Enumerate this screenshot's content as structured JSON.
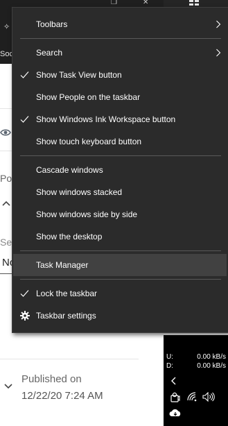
{
  "background": {
    "topbar_text": "Soc",
    "po_label": "Po",
    "se_label": "Se",
    "no_label": "No",
    "published_label": "Published on",
    "published_date": "12/22/20 7:24 AM"
  },
  "tray": {
    "upload_label": "U:",
    "upload_value": "0.00 kB/s",
    "download_label": "D:",
    "download_value": "0.00 kB/s",
    "icons": [
      "chevron-left-icon",
      "people-icon",
      "wifi-icon",
      "speaker-icon",
      "onedrive-cloud-icon"
    ]
  },
  "menu": {
    "toolbars": "Toolbars",
    "search": "Search",
    "show_task_view": "Show Task View button",
    "show_people": "Show People on the taskbar",
    "show_ink_workspace": "Show Windows Ink Workspace button",
    "show_touch_keyboard": "Show touch keyboard button",
    "cascade_windows": "Cascade windows",
    "show_stacked": "Show windows stacked",
    "show_side_by_side": "Show windows side by side",
    "show_desktop": "Show the desktop",
    "task_manager": "Task Manager",
    "lock_taskbar": "Lock the taskbar",
    "taskbar_settings": "Taskbar settings"
  }
}
